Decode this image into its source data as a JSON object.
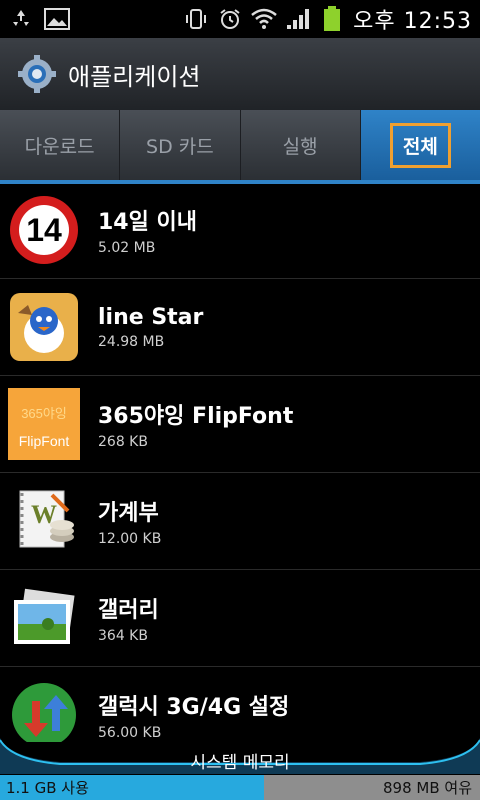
{
  "status_bar": {
    "time": "오후 12:53",
    "icons": [
      "recycle-icon",
      "image-icon",
      "vibrate-icon",
      "alarm-icon",
      "wifi-icon",
      "signal-icon",
      "battery-icon"
    ]
  },
  "title_bar": {
    "title": "애플리케이션",
    "icon": "gear-icon"
  },
  "tabs": [
    {
      "label": "다운로드",
      "active": false
    },
    {
      "label": "SD 카드",
      "active": false
    },
    {
      "label": "실행",
      "active": false
    },
    {
      "label": "전체",
      "active": true
    }
  ],
  "apps": [
    {
      "name": "14일 이내",
      "size": "5.02 MB",
      "icon": "fourteen-days-icon"
    },
    {
      "name": "line Star",
      "size": "24.98 MB",
      "icon": "line-star-icon"
    },
    {
      "name": "365야잉 FlipFont",
      "size": "268 KB",
      "icon": "flipfont-icon",
      "icon_text_top": "365야잉",
      "icon_text_bottom": "FlipFont"
    },
    {
      "name": "가계부",
      "size": "12.00 KB",
      "icon": "household-ledger-icon"
    },
    {
      "name": "갤러리",
      "size": "364 KB",
      "icon": "gallery-icon"
    },
    {
      "name": "갤럭시 3G/4G 설정",
      "size": "56.00 KB",
      "icon": "galaxy-network-icon"
    }
  ],
  "memory": {
    "title": "시스템 메모리",
    "used": "1.1 GB 사용",
    "free": "898 MB 여유",
    "used_fraction": 0.55
  },
  "colors": {
    "accent": "#2f83c8",
    "tab_highlight": "#f0a030",
    "memory_used": "#27a9de"
  }
}
